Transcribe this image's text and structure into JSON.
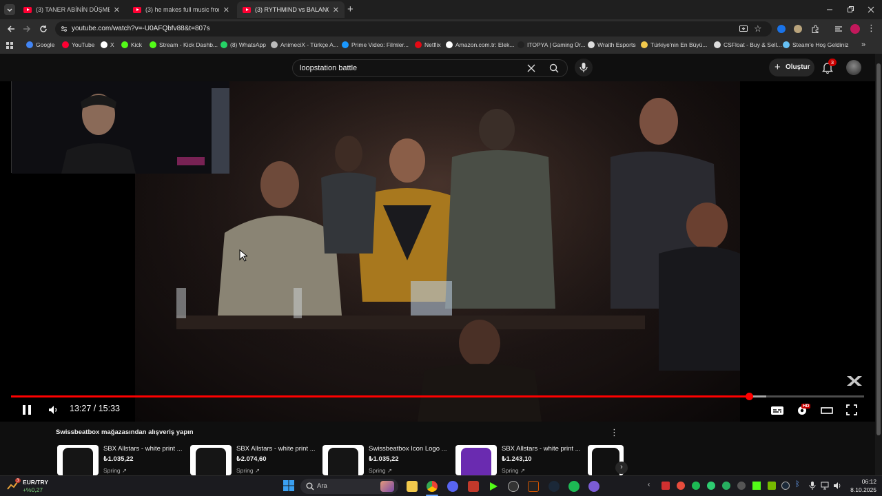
{
  "browser": {
    "tabs": [
      {
        "label": "(3) TANER ABİNİN DÜŞME SAH",
        "active": false
      },
      {
        "label": "(3) he makes full music from o",
        "active": false
      },
      {
        "label": "(3) RYTHMIND vs BALANCE",
        "active": true
      }
    ],
    "new_tab_label": "+",
    "url": "youtube.com/watch?v=-U0AFQbfv88&t=807s",
    "bookmarks": [
      {
        "label": "Google",
        "color": "#4285f4"
      },
      {
        "label": "YouTube",
        "color": "#ff0033"
      },
      {
        "label": "X",
        "color": "#ffffff"
      },
      {
        "label": "Kick",
        "color": "#53fc18"
      },
      {
        "label": "Stream - Kick Dashb...",
        "color": "#53fc18"
      },
      {
        "label": "(8) WhatsApp",
        "color": "#25d366"
      },
      {
        "label": "AnimeciX - Türkçe A...",
        "color": "#bbbbbb"
      },
      {
        "label": "Prime Video: Filmler...",
        "color": "#1a98ff"
      },
      {
        "label": "Netflix",
        "color": "#e50914"
      },
      {
        "label": "Amazon.com.tr: Elek...",
        "color": "#ffffff"
      },
      {
        "label": "ITOPYA | Gaming Ür...",
        "color": "#222222"
      },
      {
        "label": "Wraith Esports",
        "color": "#dddddd"
      },
      {
        "label": "Türkiye'nin En Büyü...",
        "color": "#f2c94c"
      },
      {
        "label": "CSFloat - Buy & Sell...",
        "color": "#dddddd"
      },
      {
        "label": "Steam'e Hoş Geldiniz",
        "color": "#66c0f4"
      }
    ]
  },
  "youtube": {
    "search_value": "loopstation battle",
    "create_label": "Oluştur",
    "notification_count": "3",
    "player": {
      "time": "13:27 / 15:33",
      "progress_fraction": 0.865,
      "buffered_fraction": 0.885,
      "quality_badge": "HD"
    },
    "shelf": {
      "title": "Swissbeatbox mağazasından alışveriş yapın",
      "products": [
        {
          "name": "SBX Allstars - white print ...",
          "price": "₺1.035,22",
          "store": "Spring",
          "shirt_color": "#151515"
        },
        {
          "name": "SBX Allstars - white print ...",
          "price": "₺2.074,60",
          "store": "Spring",
          "shirt_color": "#151515"
        },
        {
          "name": "Swissbeatbox Icon Logo ...",
          "price": "₺1.035,22",
          "store": "Spring",
          "shirt_color": "#151515"
        },
        {
          "name": "SBX Allstars - white print ...",
          "price": "₺1.243,10",
          "store": "Spring",
          "shirt_color": "#6a2bb0"
        }
      ]
    }
  },
  "taskbar": {
    "ticker_name": "EUR/TRY",
    "ticker_change": "+%0,27",
    "ticker_badge": "3",
    "search_placeholder": "Ara",
    "clock_time": "06:12",
    "clock_date": "8.10.2025"
  },
  "colors": {
    "accent_red": "#ff0000",
    "bg": "#0f0f0f"
  }
}
